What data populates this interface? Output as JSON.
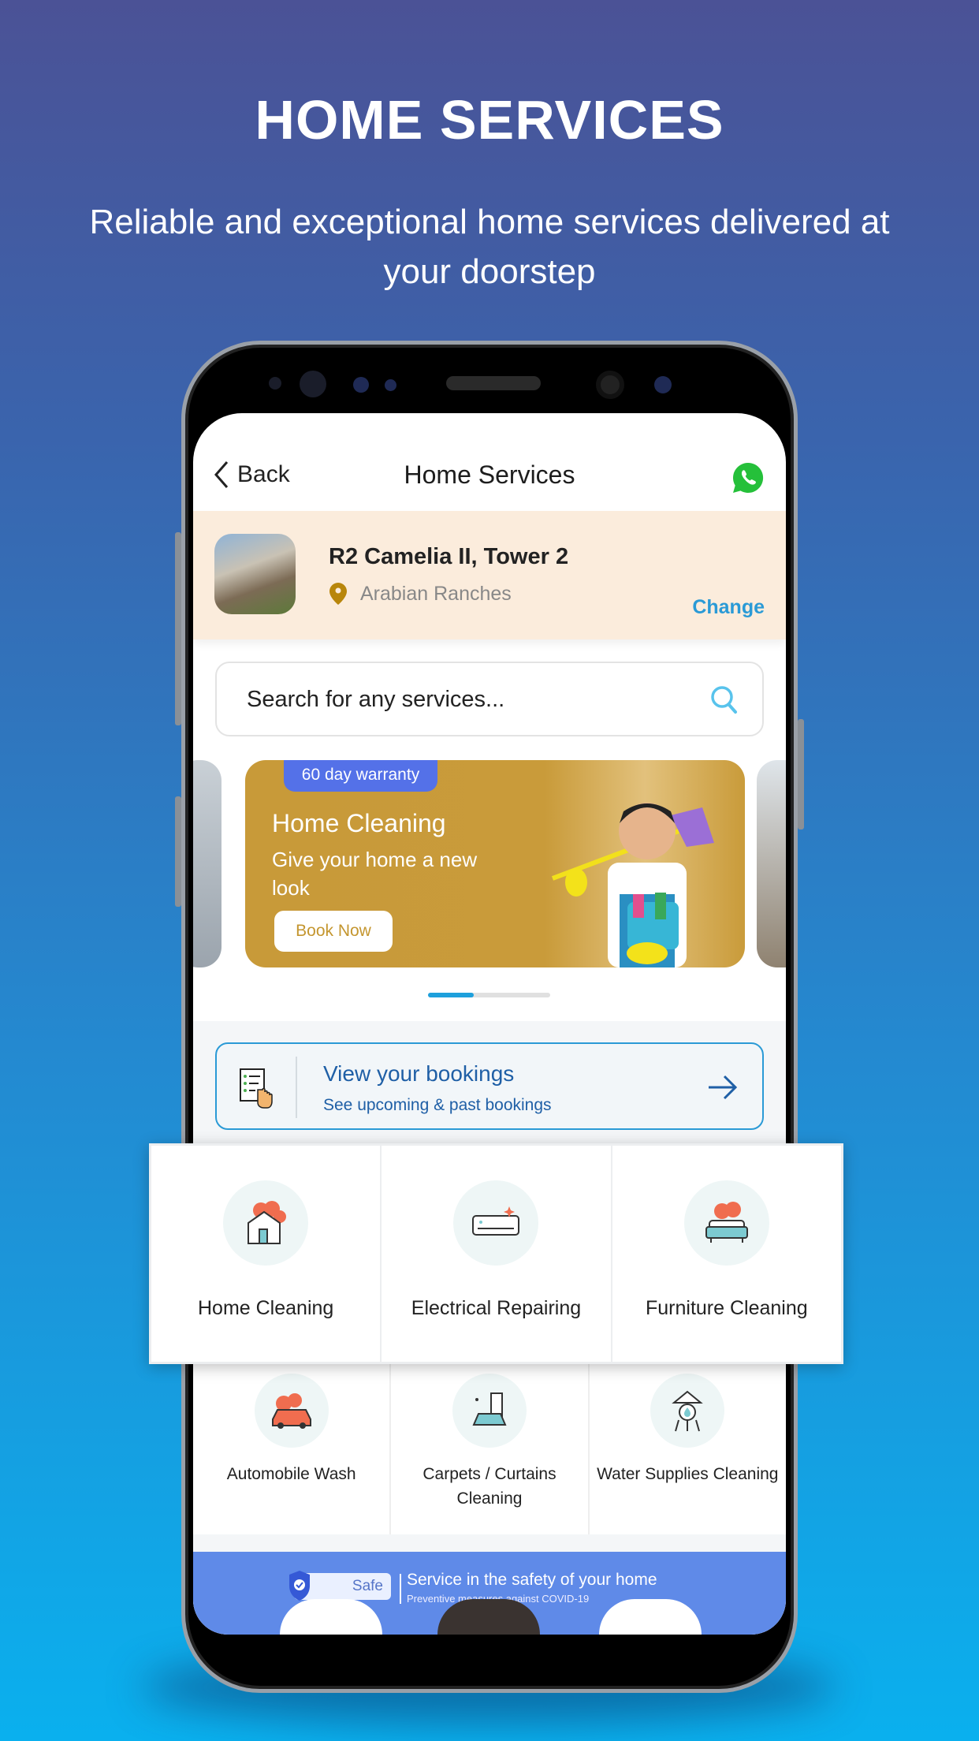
{
  "hero": {
    "title": "HOME SERVICES",
    "subtitle": "Reliable and exceptional home services delivered at your doorstep"
  },
  "header": {
    "back_label": "Back",
    "title": "Home Services",
    "whatsapp_icon": "whatsapp-icon"
  },
  "address": {
    "name": "R2 Camelia II, Tower 2",
    "location": "Arabian Ranches",
    "change_label": "Change"
  },
  "search": {
    "placeholder": "Search for any services..."
  },
  "banner": {
    "tag": "60 day warranty",
    "title": "Home Cleaning",
    "subtitle": "Give your home a new look",
    "button": "Book Now",
    "active_slide": 1,
    "total_slides": 3
  },
  "bookings": {
    "title": "View your bookings",
    "subtitle": "See upcoming & past bookings"
  },
  "services_highlighted": [
    {
      "label": "Home Cleaning",
      "icon": "house-cleaning-icon"
    },
    {
      "label": "Electrical Repairing",
      "icon": "air-conditioner-icon"
    },
    {
      "label": "Furniture Cleaning",
      "icon": "sofa-cleaning-icon"
    }
  ],
  "services": [
    {
      "label": "Automobile Wash",
      "icon": "car-wash-icon"
    },
    {
      "label": "Carpets / Curtains Cleaning",
      "icon": "carpet-cleaning-icon"
    },
    {
      "label": "Water Supplies Cleaning",
      "icon": "water-tank-icon"
    }
  ],
  "safety": {
    "badge": "Safe",
    "title": "Service in the safety of your home",
    "subtitle": "Preventive measures against COVID-19"
  },
  "colors": {
    "accent": "#2a9ad6",
    "banner": "#c99b3a",
    "tag": "#5471e8",
    "safe_banner": "#5f8ae8",
    "whatsapp": "#25c03a"
  }
}
